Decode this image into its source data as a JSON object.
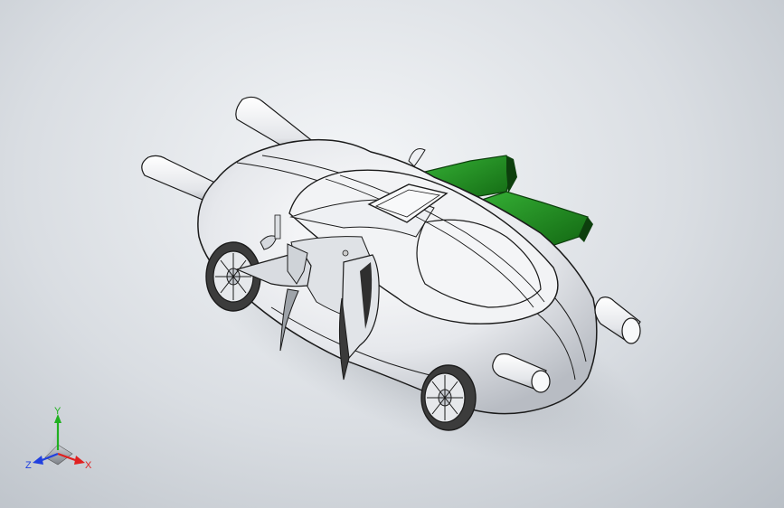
{
  "colors": {
    "background_center": "#f4f6f8",
    "background_edge": "#b9bfc6",
    "body": "#e9ebee",
    "outline": "#1b1b1b",
    "wing": "#1f8a1f",
    "wing_dark": "#0d3f0d",
    "axis_x": "#e02020",
    "axis_y": "#20b020",
    "axis_z": "#2040e0"
  },
  "model": {
    "name": "flying-car-assembly",
    "parts": [
      "body",
      "front-wing-left",
      "front-wing-right",
      "rear-thruster-left",
      "rear-thruster-right",
      "side-thruster",
      "left-doors",
      "sunroof",
      "wheels",
      "green-fins"
    ]
  },
  "triad": {
    "x_label": "X",
    "y_label": "Y",
    "z_label": "Z"
  }
}
